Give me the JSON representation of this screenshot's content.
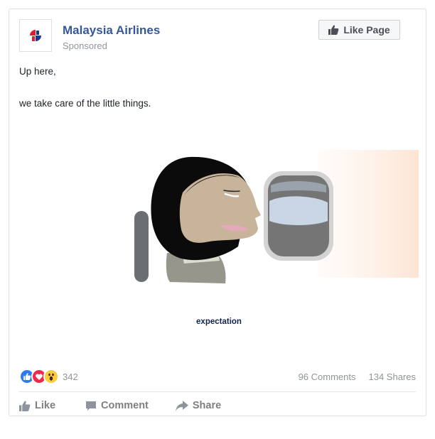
{
  "post": {
    "page_name": "Malaysia Airlines",
    "sponsored_label": "Sponsored",
    "like_page_label": "Like Page",
    "text_lines": [
      "Up here,",
      "we take care of the little things."
    ],
    "media_caption": "expectation"
  },
  "stats": {
    "reaction_count": "342",
    "comments": "96 Comments",
    "shares": "134 Shares"
  },
  "actions": {
    "like": "Like",
    "comment": "Comment",
    "share": "Share"
  },
  "colors": {
    "brand_blue": "#365899",
    "like_blue": "#2d7bf4",
    "love_red": "#f0284a",
    "wow_yellow": "#fbcd3c"
  },
  "icons": {
    "logo": "malaysia-airlines-logo-icon",
    "like_page": "thumbs-up-icon",
    "reactions": [
      "like-reaction-icon",
      "love-reaction-icon",
      "wow-reaction-icon"
    ],
    "actions": [
      "thumbs-up-icon",
      "comment-icon",
      "share-icon"
    ]
  }
}
